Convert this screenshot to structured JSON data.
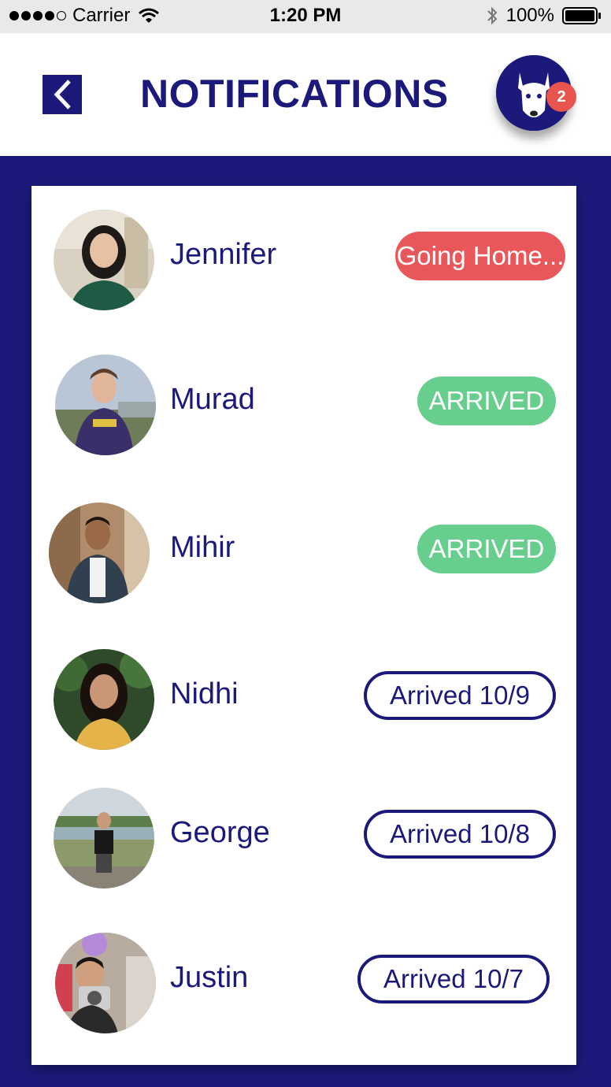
{
  "status_bar": {
    "carrier": "Carrier",
    "time": "1:20 PM",
    "battery": "100%"
  },
  "header": {
    "title": "NOTIFICATIONS",
    "badge_count": "2"
  },
  "colors": {
    "primary": "#1b1a7a",
    "going_home": "#e8585a",
    "arrived": "#68ce8e",
    "badge": "#e8554f"
  },
  "people": [
    {
      "name": "Jennifer",
      "status": "Going Home...",
      "status_type": "red"
    },
    {
      "name": "Murad",
      "status": "ARRIVED",
      "status_type": "green"
    },
    {
      "name": "Mihir",
      "status": "ARRIVED",
      "status_type": "green"
    },
    {
      "name": "Nidhi",
      "status": "Arrived 10/9",
      "status_type": "outline"
    },
    {
      "name": "George",
      "status": "Arrived 10/8",
      "status_type": "outline"
    },
    {
      "name": "Justin",
      "status": "Arrived 10/7",
      "status_type": "outline"
    }
  ]
}
